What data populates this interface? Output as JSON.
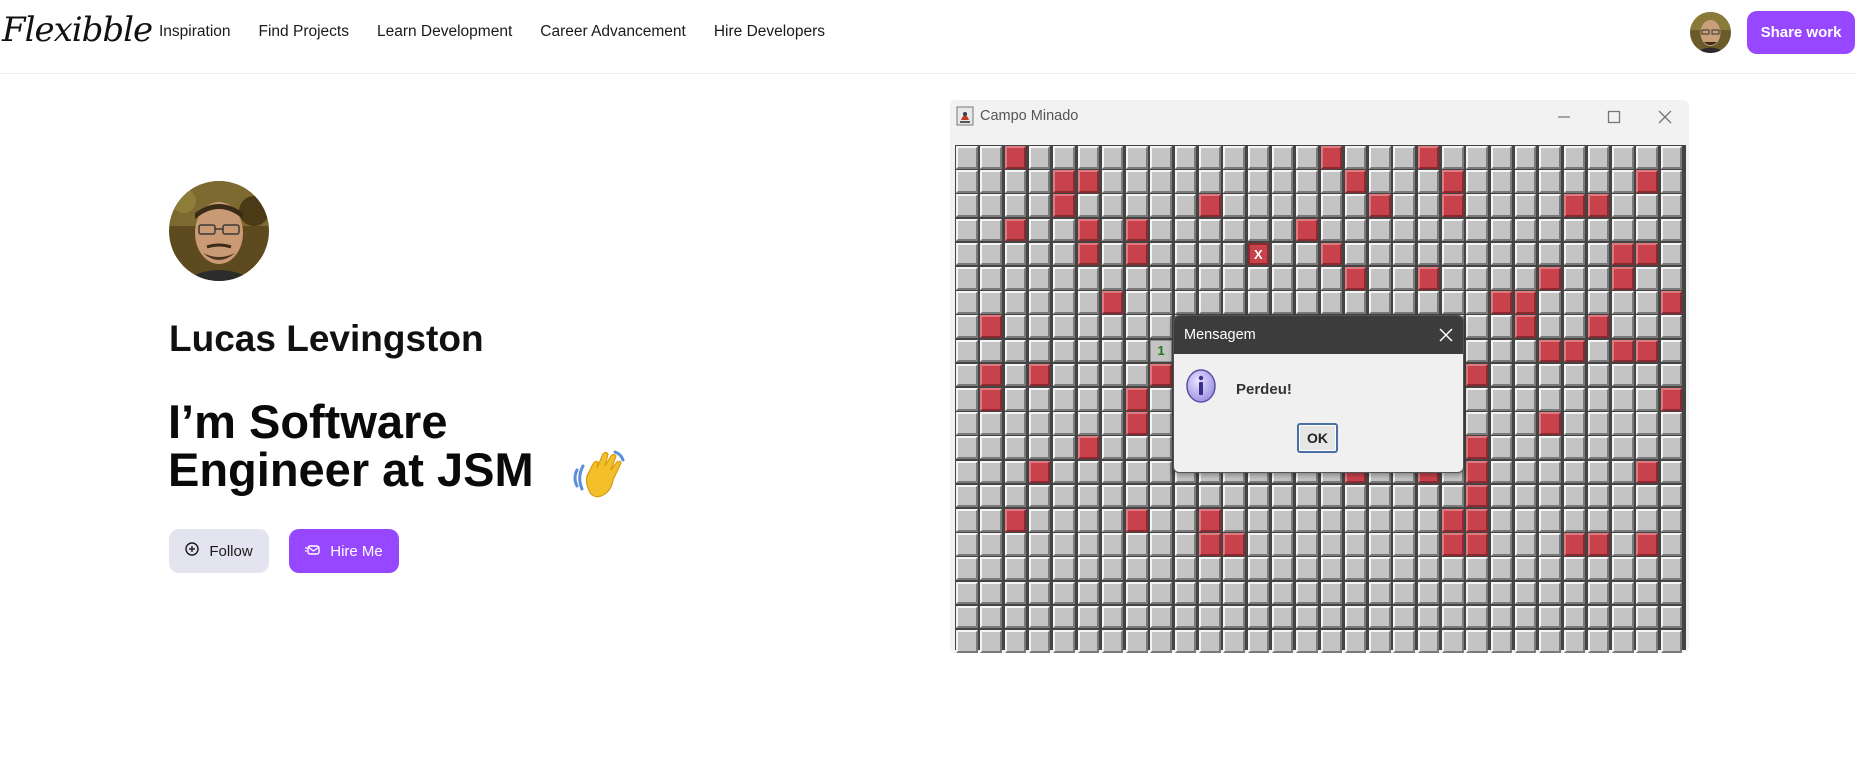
{
  "nav": {
    "logo": "Flexibble",
    "links": [
      "Inspiration",
      "Find Projects",
      "Learn Development",
      "Career Advancement",
      "Hire Developers"
    ],
    "share_label": "Share work"
  },
  "profile": {
    "name": "Lucas Levingston",
    "headline_line1": "I’m Software",
    "headline_line2": "Engineer at JSM",
    "follow_label": "Follow",
    "hire_label": "Hire Me"
  },
  "game": {
    "window_title": "Campo Minado",
    "hit_marker": "X",
    "revealed_number": "1",
    "dialog": {
      "title": "Mensagem",
      "message": "Perdeu!",
      "ok_label": "OK"
    }
  },
  "colors": {
    "accent": "#9747ff",
    "mine_red": "#c8424b",
    "cell_gray": "#c4c4c4",
    "dialog_titlebar": "#3c3c3c"
  }
}
